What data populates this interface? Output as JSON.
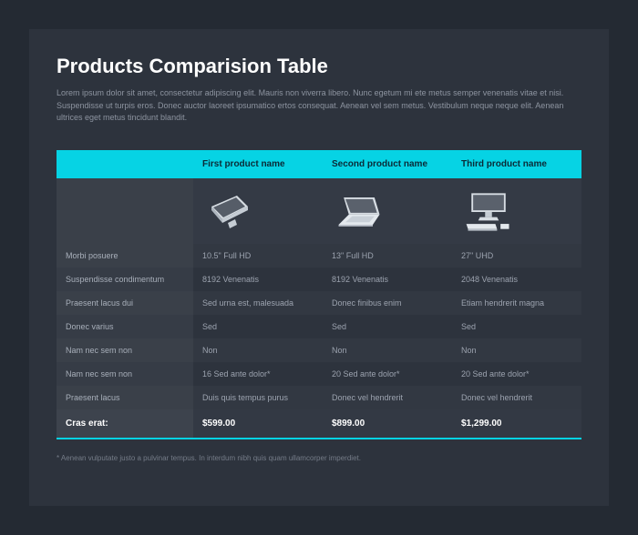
{
  "title": "Products Comparision Table",
  "intro": "Lorem ipsum dolor sit amet, consectetur adipiscing elit. Mauris non viverra libero. Nunc egetum mi ete metus semper venenatis vitae et nisi. Suspendisse ut turpis eros. Donec auctor laoreet ipsumatico ertos consequat. Aenean vel sem metus. Vestibulum neque neque elit. Aenean ultrices eget metus tincidunt blandit.",
  "columns": [
    "First product name",
    "Second product name",
    "Third product name"
  ],
  "rows": [
    {
      "label": "Morbi posuere",
      "values": [
        "10.5\" Full HD",
        "13\" Full HD",
        "27\" UHD"
      ]
    },
    {
      "label": "Suspendisse condimentum",
      "values": [
        "8192 Venenatis",
        "8192 Venenatis",
        "2048 Venenatis"
      ]
    },
    {
      "label": "Praesent lacus dui",
      "values": [
        "Sed urna est, malesuada",
        "Donec finibus enim",
        "Etiam hendrerit magna"
      ]
    },
    {
      "label": "Donec varius",
      "values": [
        "Sed",
        "Sed",
        "Sed"
      ]
    },
    {
      "label": "Nam nec sem non",
      "values": [
        "Non",
        "Non",
        "Non"
      ]
    },
    {
      "label": "Nam nec sem non",
      "values": [
        "16 Sed ante dolor*",
        "20 Sed ante dolor*",
        "20 Sed ante dolor*"
      ]
    },
    {
      "label": "Praesent lacus",
      "values": [
        "Duis quis tempus purus",
        "Donec vel hendrerit",
        "Donec vel hendrerit"
      ]
    }
  ],
  "total": {
    "label": "Cras erat:",
    "values": [
      "$599.00",
      "$899.00",
      "$1,299.00"
    ]
  },
  "footnote": "* Aenean vulputate justo a pulvinar tempus. In interdum nibh quis quam ullamcorper imperdiet."
}
